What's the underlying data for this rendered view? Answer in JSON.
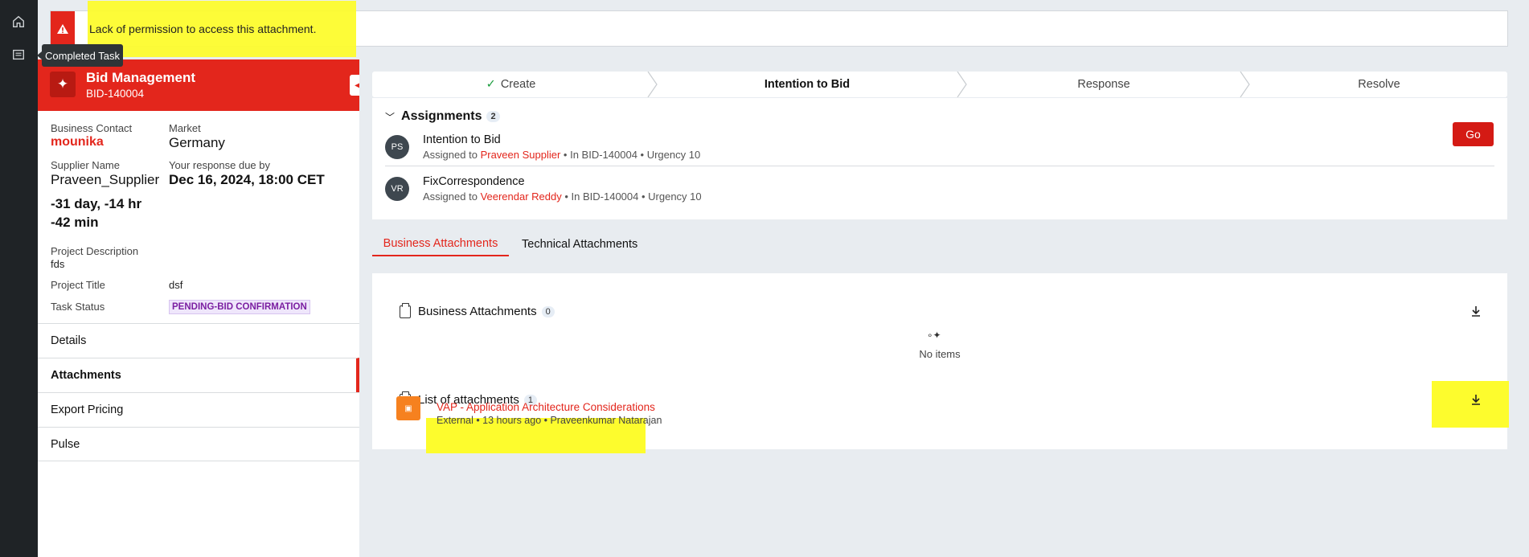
{
  "nav": {
    "home_icon": "home-icon",
    "tasks_icon": "list-icon"
  },
  "tooltip": "Completed Task",
  "banner": {
    "message": "Lack of permission to access this attachment.",
    "icon": "warning-icon"
  },
  "bid": {
    "title": "Bid Management",
    "id": "BID-140004"
  },
  "details": {
    "business_contact_label": "Business Contact",
    "business_contact": "mounika",
    "market_label": "Market",
    "market": "Germany",
    "supplier_label": "Supplier Name",
    "supplier": "Praveen_Supplier",
    "response_due_label": "Your response due by",
    "response_due": "Dec 16, 2024, 18:00 CET",
    "countdown_1": "-31 day, -14 hr",
    "countdown_2": "-42 min",
    "project_description_label": "Project Description",
    "project_description": "fds",
    "project_title_label": "Project Title",
    "project_title": "dsf",
    "task_status_label": "Task Status",
    "task_status": "PENDING-BID CONFIRMATION"
  },
  "menu": [
    "Details",
    "Attachments",
    "Export Pricing",
    "Pulse"
  ],
  "stepper": [
    "Create",
    "Intention to Bid",
    "Response",
    "Resolve"
  ],
  "assignments": {
    "title": "Assignments",
    "count": "2",
    "items": [
      {
        "initials": "PS",
        "title": "Intention to Bid",
        "prefix": "Assigned to",
        "assignee": "Praveen Supplier",
        "meta": "• In BID-140004 • Urgency 10"
      },
      {
        "initials": "VR",
        "title": "FixCorrespondence",
        "prefix": "Assigned to",
        "assignee": "Veerendar Reddy",
        "meta": "• In BID-140004 • Urgency 10"
      }
    ],
    "go_label": "Go"
  },
  "tabs": [
    "Business Attachments",
    "Technical Attachments"
  ],
  "business_attachments": {
    "title": "Business Attachments",
    "count": "0",
    "empty": "No items"
  },
  "attachments_list": {
    "title": "List of attachments",
    "count": "1",
    "file": {
      "name": "VAP - Application Architecture Considerations",
      "meta": "External • 13 hours ago • Praveenkumar Natarajan"
    }
  },
  "colors": {
    "brand_red": "#e3261c",
    "highlight": "#fdfc2d"
  }
}
